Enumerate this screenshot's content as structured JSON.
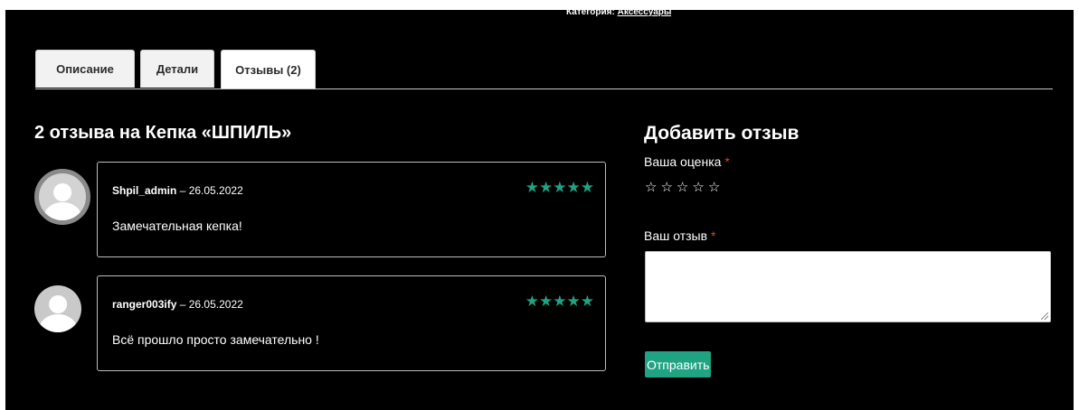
{
  "category": {
    "label": "Категория:",
    "link": "Аксессуары"
  },
  "tabs": [
    {
      "label": "Описание"
    },
    {
      "label": "Детали"
    },
    {
      "label": "Отзывы (2)"
    }
  ],
  "reviews": {
    "title": "2 отзыва на Кепка «ШПИЛЬ»",
    "items": [
      {
        "author": "Shpil_admin",
        "date": "– 26.05.2022",
        "stars": "★★★★★",
        "text": "Замечательная кепка!"
      },
      {
        "author": "ranger003ify",
        "date": "– 26.05.2022",
        "stars": "★★★★★",
        "text": "Всё прошло просто замечательно !"
      }
    ]
  },
  "form": {
    "title": "Добавить отзыв",
    "rating_label": "Ваша оценка",
    "required_mark": "*",
    "rating_stars": [
      "☆",
      "☆",
      "☆",
      "☆",
      "☆"
    ],
    "review_label": "Ваш отзыв",
    "submit_label": "Отправить"
  },
  "colors": {
    "background": "#000000",
    "accent": "#1fa383",
    "required": "#e2401c"
  }
}
